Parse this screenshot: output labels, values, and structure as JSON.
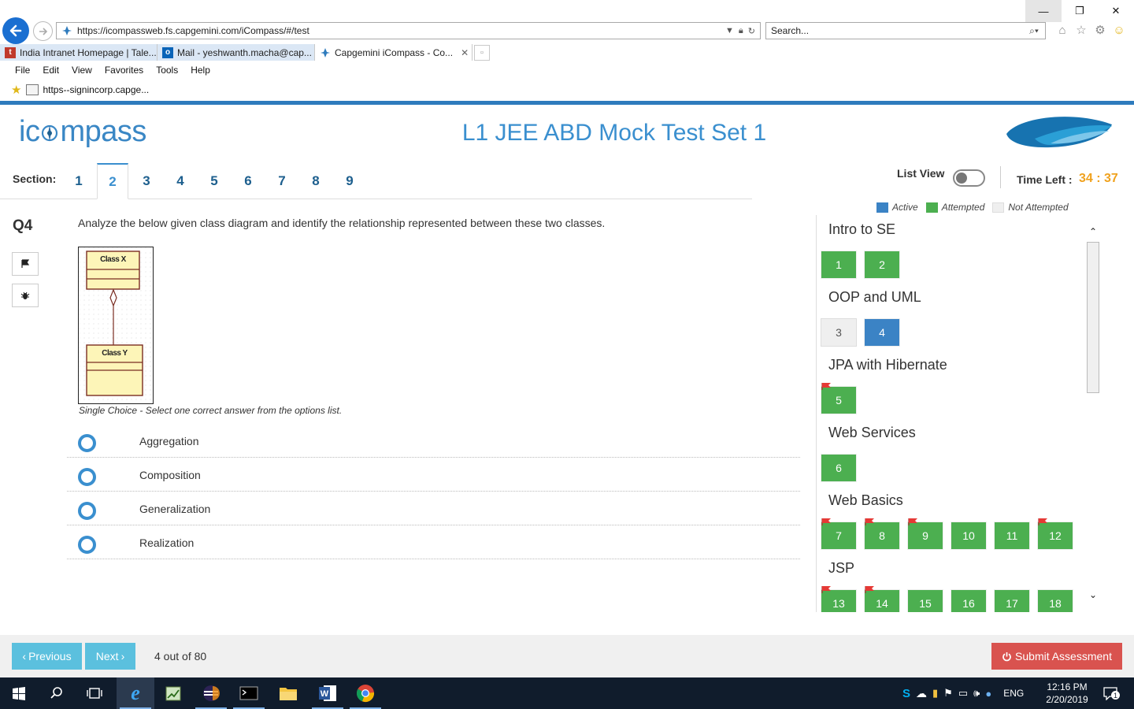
{
  "browser": {
    "url": "https://icompassweb.fs.capgemini.com/iCompass/#/test",
    "search_placeholder": "Search...",
    "tabs": [
      {
        "label": "India Intranet Homepage | Tale..."
      },
      {
        "label": "Mail - yeshwanth.macha@cap..."
      },
      {
        "label": "Capgemini iCompass - Co..."
      }
    ],
    "menu": [
      "File",
      "Edit",
      "View",
      "Favorites",
      "Tools",
      "Help"
    ],
    "favorite": "https--signincorp.capge..."
  },
  "header": {
    "logo_left": "ic",
    "logo_right": "mpass",
    "title": "L1 JEE ABD Mock Test Set 1"
  },
  "sections": {
    "label": "Section:",
    "items": [
      "1",
      "2",
      "3",
      "4",
      "5",
      "6",
      "7",
      "8",
      "9"
    ],
    "active": "2"
  },
  "controls": {
    "list_view_label": "List View",
    "list_view_on": false,
    "time_left_label": "Time Left :",
    "time_left_value": "34 : 37"
  },
  "legend": [
    {
      "label": "Active",
      "color": "#3b83c5"
    },
    {
      "label": "Attempted",
      "color": "#4caf50"
    },
    {
      "label": "Not Attempted",
      "color": "#efefef"
    }
  ],
  "question": {
    "number": "Q4",
    "text": "Analyze the below given class diagram and identify the relationship represented between these two classes.",
    "diagram": {
      "class_top": "Class X",
      "class_bottom": "Class Y"
    },
    "instruction": "Single Choice - Select one correct answer from the options list.",
    "options": [
      "Aggregation",
      "Composition",
      "Generalization",
      "Realization"
    ]
  },
  "palette": {
    "groups": [
      {
        "title": "Intro to SE",
        "questions": [
          {
            "n": "1",
            "state": "attempted",
            "flag": false
          },
          {
            "n": "2",
            "state": "attempted",
            "flag": false
          }
        ]
      },
      {
        "title": "OOP and UML",
        "questions": [
          {
            "n": "3",
            "state": "not_attempted",
            "flag": false
          },
          {
            "n": "4",
            "state": "active",
            "flag": false
          }
        ]
      },
      {
        "title": "JPA with Hibernate",
        "questions": [
          {
            "n": "5",
            "state": "attempted",
            "flag": true
          }
        ]
      },
      {
        "title": "Web Services",
        "questions": [
          {
            "n": "6",
            "state": "attempted",
            "flag": false
          }
        ]
      },
      {
        "title": "Web Basics",
        "questions": [
          {
            "n": "7",
            "state": "attempted",
            "flag": true
          },
          {
            "n": "8",
            "state": "attempted",
            "flag": true
          },
          {
            "n": "9",
            "state": "attempted",
            "flag": true
          },
          {
            "n": "10",
            "state": "attempted",
            "flag": false
          },
          {
            "n": "11",
            "state": "attempted",
            "flag": false
          },
          {
            "n": "12",
            "state": "attempted",
            "flag": true
          }
        ]
      },
      {
        "title": "JSP",
        "questions": [
          {
            "n": "13",
            "state": "attempted",
            "flag": true
          },
          {
            "n": "14",
            "state": "attempted",
            "flag": true
          },
          {
            "n": "15",
            "state": "attempted",
            "flag": false
          },
          {
            "n": "16",
            "state": "attempted",
            "flag": false
          },
          {
            "n": "17",
            "state": "attempted",
            "flag": false
          },
          {
            "n": "18",
            "state": "attempted",
            "flag": false
          }
        ]
      }
    ]
  },
  "footer": {
    "previous_label": "Previous",
    "next_label": "Next",
    "count_text": "4 out of 80",
    "submit_label": "Submit Assessment"
  },
  "taskbar": {
    "language": "ENG",
    "time": "12:16 PM",
    "date": "2/20/2019",
    "notifications": "1"
  }
}
